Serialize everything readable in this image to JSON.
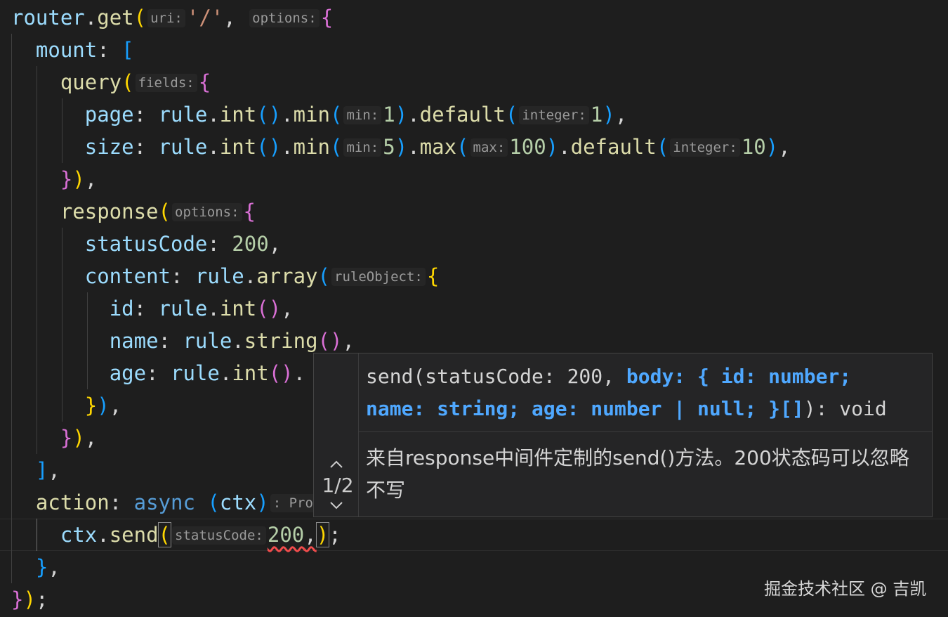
{
  "code": {
    "line1": {
      "router": "router",
      "dot": ".",
      "get": "get",
      "open": "(",
      "hint_uri": "uri:",
      "path": "'/'",
      "comma": ", ",
      "hint_options": "options:",
      "brace": "{"
    },
    "line2": {
      "mount": "mount",
      "colon": ": ",
      "bracket": "["
    },
    "line3": {
      "query": "query",
      "open": "(",
      "hint_fields": "fields:",
      "brace": "{"
    },
    "line4": {
      "page": "page",
      "colon": ": ",
      "rule": "rule",
      "dot1": ".",
      "int": "int",
      "parens1": "()",
      "dot2": ".",
      "min": "min",
      "open1": "(",
      "hint_min": "min:",
      "minval": "1",
      "close1": ")",
      "dot3": ".",
      "default": "default",
      "open2": "(",
      "hint_integer": "integer:",
      "defval": "1",
      "close2": ")",
      "comma": ","
    },
    "line5": {
      "size": "size",
      "colon": ": ",
      "rule": "rule",
      "dot1": ".",
      "int": "int",
      "parens1": "()",
      "dot2": ".",
      "min": "min",
      "open1": "(",
      "hint_min": "min:",
      "minval": "5",
      "close1": ")",
      "dot3": ".",
      "max": "max",
      "open2": "(",
      "hint_max": "max:",
      "maxval": "100",
      "close2": ")",
      "dot4": ".",
      "default": "default",
      "open3": "(",
      "hint_integer": "integer:",
      "defval": "10",
      "close3": ")",
      "comma": ","
    },
    "line6": {
      "brace": "}",
      "paren": ")",
      "comma": ","
    },
    "line7": {
      "response": "response",
      "open": "(",
      "hint_options": "options:",
      "brace": "{"
    },
    "line8": {
      "statusCode": "statusCode",
      "colon": ": ",
      "val": "200",
      "comma": ","
    },
    "line9": {
      "content": "content",
      "colon": ": ",
      "rule": "rule",
      "dot": ".",
      "array": "array",
      "open": "(",
      "hint_ruleObject": "ruleObject:",
      "brace": "{"
    },
    "line10": {
      "id": "id",
      "colon": ": ",
      "rule": "rule",
      "dot": ".",
      "int": "int",
      "parens": "()",
      "comma": ","
    },
    "line11": {
      "name": "name",
      "colon": ": ",
      "rule": "rule",
      "dot": ".",
      "string": "string",
      "parens": "()",
      "comma": ","
    },
    "line12": {
      "age": "age",
      "colon": ": ",
      "rule": "rule",
      "dot1": ".",
      "int": "int",
      "parens": "()",
      "dot2": "."
    },
    "line13": {
      "brace": "}",
      "paren": ")",
      "comma": ","
    },
    "line14": {
      "brace": "}",
      "paren": ")",
      "comma": ","
    },
    "line15": {
      "bracket": "]",
      "comma": ","
    },
    "line16": {
      "action": "action",
      "colon": ": ",
      "async": "async",
      "space": " ",
      "open": "(",
      "ctx": "ctx",
      "close": ")",
      "hint_type": ": Pro"
    },
    "line17": {
      "ctx": "ctx",
      "dot": ".",
      "send": "send",
      "open": "(",
      "hint_statusCode": "statusCode:",
      "val": "200",
      "comma": ",",
      "close": ")",
      "semi": ";"
    },
    "line18": {
      "brace": "}",
      "comma": ","
    },
    "line19": {
      "brace": "}",
      "paren": ")",
      "semi": ";"
    }
  },
  "signature_help": {
    "counter": "1/2",
    "up_icon": "chevron-up-icon",
    "down_icon": "chevron-down-icon",
    "sig_prefix": "send(statusCode: 200, ",
    "sig_active_1": "body: { id: number;",
    "sig_active_2": "name: string; age: number | null; }[]",
    "sig_suffix": "): void",
    "doc": "来自response中间件定制的send()方法。200状态码可以忽略不写"
  },
  "watermark": "掘金技术社区 @ 吉凯",
  "colors": {
    "background": "#1e1e1e",
    "property": "#9cdcfe",
    "function": "#dcdcaa",
    "string": "#ce9178",
    "number": "#b5cea8",
    "keyword": "#569cd6",
    "bracket_gold": "#ffd700",
    "bracket_purple": "#da70d6",
    "bracket_blue": "#179fff",
    "active_param": "#4fa8ff",
    "error_squiggle": "#f14c4c"
  }
}
